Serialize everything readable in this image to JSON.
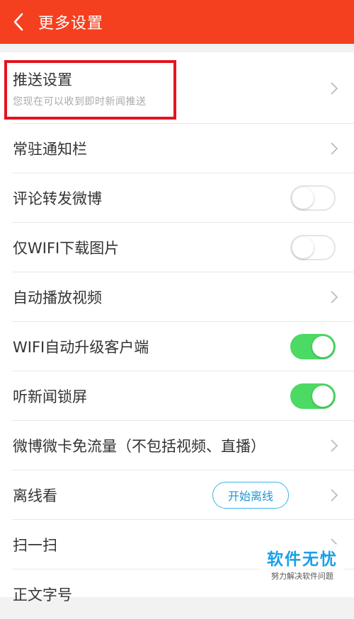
{
  "header": {
    "title": "更多设置"
  },
  "push": {
    "label": "推送设置",
    "subtitle": "您现在可以收到即时新闻推送"
  },
  "rows": [
    {
      "label": "常驻通知栏"
    },
    {
      "label": "评论转发微博",
      "toggle": "off"
    },
    {
      "label": "仅WIFI下载图片",
      "toggle": "off"
    },
    {
      "label": "自动播放视频"
    },
    {
      "label": "WIFI自动升级客户端",
      "toggle": "on"
    },
    {
      "label": "听新闻锁屏",
      "toggle": "on"
    },
    {
      "label": "微博微卡免流量（不包括视频、直播）"
    },
    {
      "label": "离线看",
      "button": "开始离线"
    },
    {
      "label": "扫一扫"
    },
    {
      "label": "正文字号"
    }
  ],
  "watermark": {
    "title": "软件无忧",
    "subtitle": "努力解决软件问题"
  },
  "colors": {
    "header": "#f5401f",
    "toggle_on": "#4cd964",
    "highlight": "#e3141f",
    "button_border": "#3bb4e8"
  }
}
